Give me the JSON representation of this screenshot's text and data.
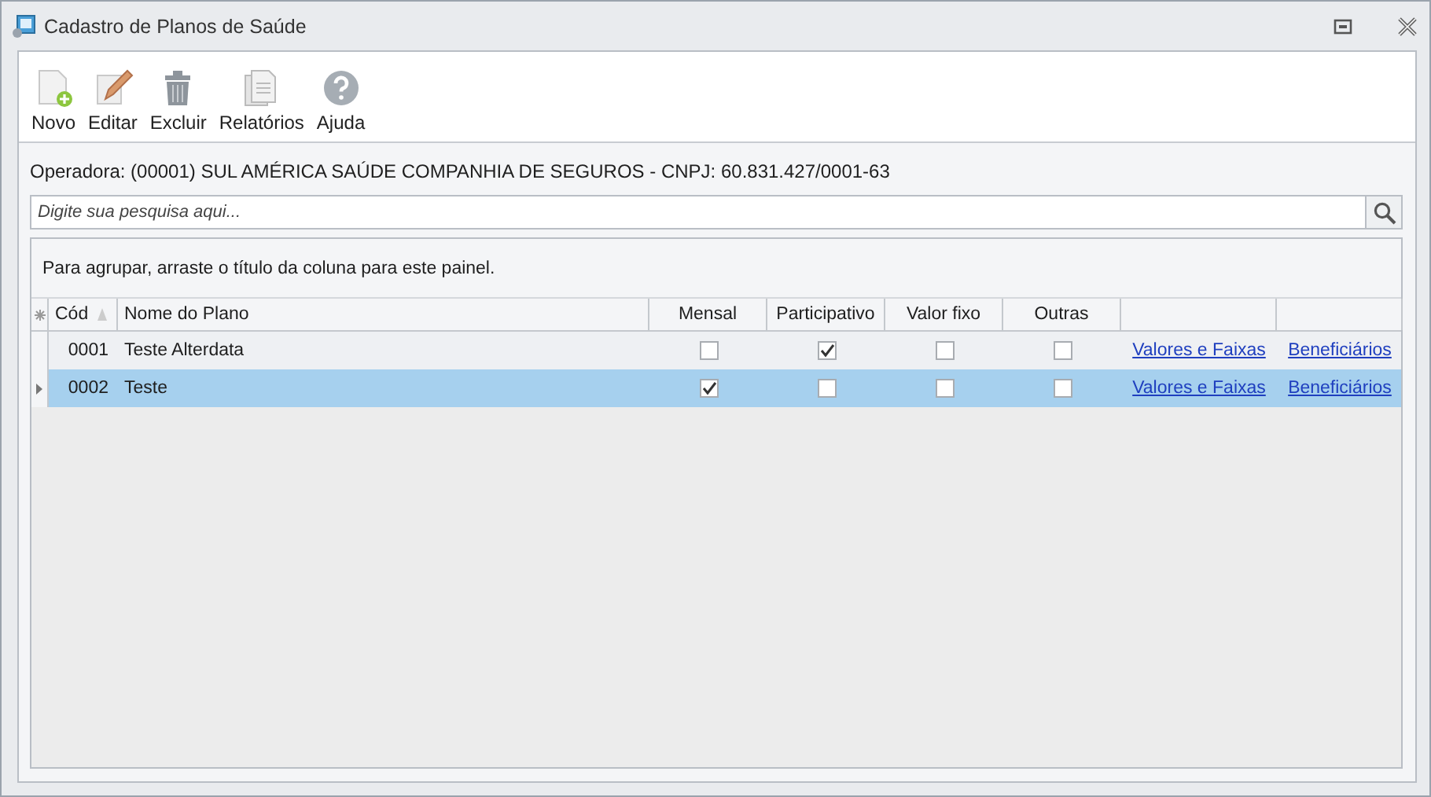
{
  "window": {
    "title": "Cadastro de Planos de Saúde"
  },
  "toolbar": [
    {
      "label": "Novo",
      "kind": "new"
    },
    {
      "label": "Editar",
      "kind": "edit"
    },
    {
      "label": "Excluir",
      "kind": "delete"
    },
    {
      "label": "Relatórios",
      "kind": "reports"
    },
    {
      "label": "Ajuda",
      "kind": "help"
    }
  ],
  "operator": "Operadora: (00001) SUL AMÉRICA SAÚDE COMPANHIA DE SEGUROS - CNPJ: 60.831.427/0001-63",
  "search": {
    "placeholder": "Digite sua pesquisa aqui..."
  },
  "group_panel": "Para agrupar, arraste o título da coluna para este painel.",
  "table": {
    "columns": [
      "Cód",
      "Nome do Plano",
      "Mensal",
      "Participativo",
      "Valor fixo",
      "Outras"
    ],
    "rows": [
      {
        "code": "0001",
        "name": "Teste Alterdata",
        "mensal": false,
        "participativo": true,
        "valor_fixo": false,
        "outras": false,
        "link_1": "Valores e Faixas",
        "link_2": "Beneficiários",
        "selected": false
      },
      {
        "code": "0002",
        "name": "Teste",
        "mensal": true,
        "participativo": false,
        "valor_fixo": false,
        "outras": false,
        "link_1": "Valores e Faixas",
        "link_2": "Beneficiários",
        "selected": true
      }
    ]
  }
}
